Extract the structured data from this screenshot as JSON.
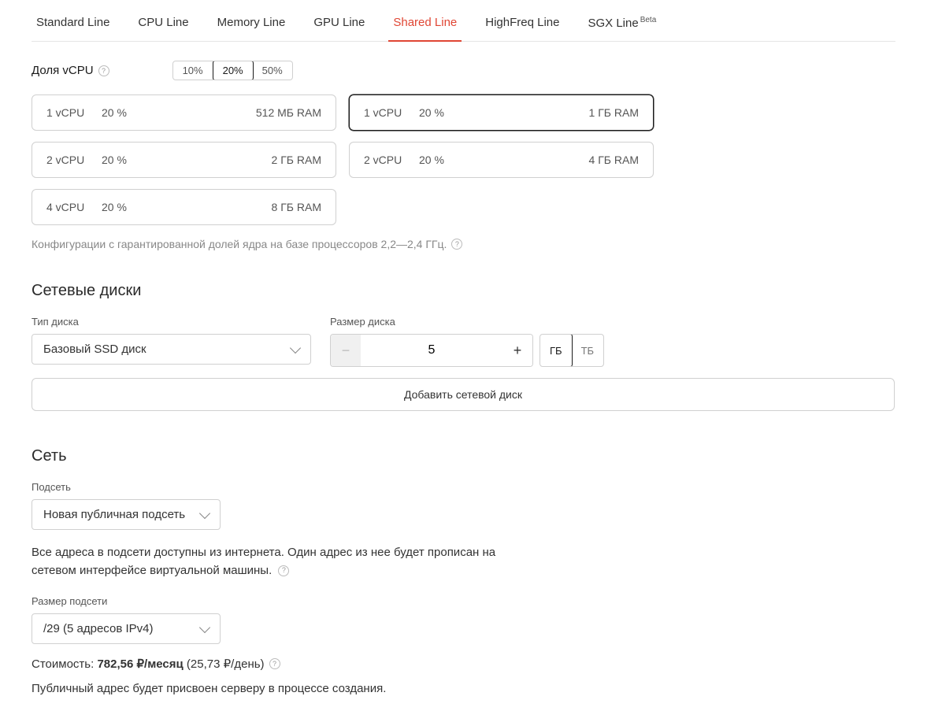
{
  "tabs": [
    {
      "label": "Standard Line"
    },
    {
      "label": "CPU Line"
    },
    {
      "label": "Memory Line"
    },
    {
      "label": "GPU Line"
    },
    {
      "label": "Shared Line",
      "active": true
    },
    {
      "label": "HighFreq Line"
    },
    {
      "label": "SGX Line",
      "beta": "Beta"
    }
  ],
  "vcpu_share": {
    "label": "Доля vCPU",
    "options": [
      "10%",
      "20%",
      "50%"
    ],
    "selected": "20%"
  },
  "configs": [
    {
      "cpu": "1 vCPU",
      "pct": "20 %",
      "ram": "512 МБ RAM"
    },
    {
      "cpu": "1 vCPU",
      "pct": "20 %",
      "ram": "1 ГБ RAM",
      "selected": true
    },
    {
      "cpu": "2 vCPU",
      "pct": "20 %",
      "ram": "2 ГБ RAM"
    },
    {
      "cpu": "2 vCPU",
      "pct": "20 %",
      "ram": "4 ГБ RAM"
    },
    {
      "cpu": "4 vCPU",
      "pct": "20 %",
      "ram": "8 ГБ RAM"
    }
  ],
  "config_hint": "Конфигурации с гарантированной долей ядра на базе процессоров 2,2—2,4 ГГц.",
  "disks": {
    "title": "Сетевые диски",
    "type_label": "Тип диска",
    "type_value": "Базовый SSD диск",
    "size_label": "Размер диска",
    "size_value": "5",
    "unit_options": [
      "ГБ",
      "ТБ"
    ],
    "unit_selected": "ГБ",
    "add_label": "Добавить сетевой диск"
  },
  "network": {
    "title": "Сеть",
    "subnet_label": "Подсеть",
    "subnet_value": "Новая публичная подсеть",
    "subnet_hint": "Все адреса в подсети доступны из интернета. Один адрес из нее будет прописан на сетевом интерфейсе виртуальной машины.",
    "size_label": "Размер подсети",
    "size_value": "/29 (5 адресов IPv4)",
    "cost_prefix": "Стоимость: ",
    "cost_value": "782,56 ₽/месяц",
    "cost_day": " (25,73 ₽/день)",
    "public_note": "Публичный адрес будет присвоен серверу в процессе создания."
  }
}
